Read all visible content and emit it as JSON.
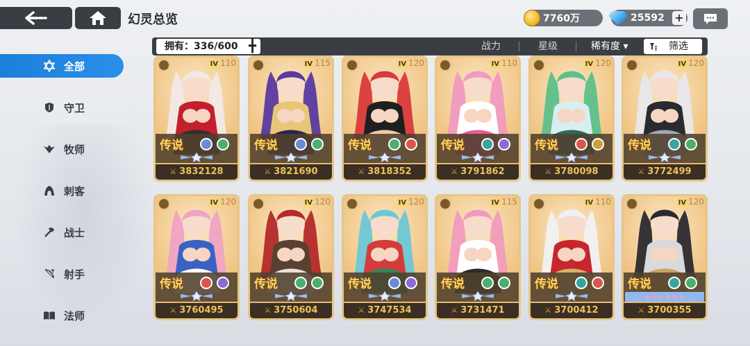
{
  "header": {
    "title": "幻灵总览",
    "gold": "7760万",
    "gems": "25592"
  },
  "toolbar": {
    "owned": "拥有：336/600",
    "sort": [
      "战力",
      "星级"
    ],
    "rarity_label": "稀有度 ▾",
    "filter_label": "筛选"
  },
  "sidebar": {
    "items": [
      {
        "label": "全部",
        "icon": "star-of-david-icon",
        "active": true
      },
      {
        "label": "守卫",
        "icon": "shield-icon"
      },
      {
        "label": "牧师",
        "icon": "wings-icon"
      },
      {
        "label": "刺客",
        "icon": "hood-icon"
      },
      {
        "label": "战士",
        "icon": "axe-icon"
      },
      {
        "label": "射手",
        "icon": "bow-icon"
      },
      {
        "label": "法师",
        "icon": "book-icon"
      }
    ]
  },
  "cards": [
    {
      "level": "110",
      "rarity": "传说",
      "power": "3832128",
      "palette": [
        "#f2e9e6",
        "#c2202e",
        "#3b2a2a"
      ],
      "elements": [
        "#6a8bd6",
        "#4caf6e"
      ]
    },
    {
      "level": "115",
      "rarity": "传说",
      "power": "3821690",
      "palette": [
        "#5a3aa0",
        "#e7c777",
        "#2c2450"
      ],
      "elements": [
        "#6a8bd6",
        "#4caf6e"
      ]
    },
    {
      "level": "120",
      "rarity": "传说",
      "power": "3818352",
      "palette": [
        "#d93a3a",
        "#1f1f1f",
        "#f1c7a5"
      ],
      "elements": [
        "#4caf6e",
        "#d9574a"
      ]
    },
    {
      "level": "110",
      "rarity": "传说",
      "power": "3791862",
      "palette": [
        "#f09ac0",
        "#ffffff",
        "#e85b96"
      ],
      "elements": [
        "#3aa3a0",
        "#8b6bd6"
      ]
    },
    {
      "level": "120",
      "rarity": "传说",
      "power": "3780098",
      "palette": [
        "#5cc08a",
        "#d8eef0",
        "#2b6b58"
      ],
      "elements": [
        "#d9574a",
        "#c9a33a"
      ]
    },
    {
      "level": "120",
      "rarity": "传说",
      "power": "3772499",
      "palette": [
        "#e8e8ec",
        "#2a2a30",
        "#9fa6b8"
      ],
      "elements": [
        "#3aa3a0",
        "#4caf6e"
      ]
    },
    {
      "level": "120",
      "rarity": "传说",
      "power": "3760495",
      "palette": [
        "#f0a3c4",
        "#3a62c4",
        "#ffffff"
      ],
      "elements": [
        "#d9574a",
        "#8b6bd6"
      ]
    },
    {
      "level": "120",
      "rarity": "传说",
      "power": "3750604",
      "palette": [
        "#b32a2a",
        "#5a4030",
        "#e9e2da"
      ],
      "elements": [
        "#4caf6e",
        "#4caf6e"
      ]
    },
    {
      "level": "120",
      "rarity": "传说",
      "power": "3747534",
      "palette": [
        "#6cc7d6",
        "#d43c3c",
        "#2e8a5a"
      ],
      "elements": [
        "#6a8bd6",
        "#8b6bd6"
      ]
    },
    {
      "level": "115",
      "rarity": "传说",
      "power": "3731471",
      "palette": [
        "#f29bbd",
        "#ffffff",
        "#2a2a2a"
      ],
      "elements": [
        "#4caf6e",
        "#4caf6e"
      ]
    },
    {
      "level": "110",
      "rarity": "传说",
      "power": "3700412",
      "palette": [
        "#f1f1f3",
        "#c6262e",
        "#d7b26a"
      ],
      "elements": [
        "#3aa3a0",
        "#d9574a"
      ]
    },
    {
      "level": "120",
      "rarity": "传说",
      "power": "3700355",
      "palette": [
        "#2a2a2e",
        "#d9d9de",
        "#c9a45a"
      ],
      "elements": [
        "#3aa3a0",
        "#4caf6e"
      ],
      "stars_row": true
    }
  ],
  "colors": {
    "accent": "#1c7fd9",
    "dark_bar": "#3a3d44",
    "card_gold": "#f0c98c",
    "power_text": "#f0c15a"
  }
}
